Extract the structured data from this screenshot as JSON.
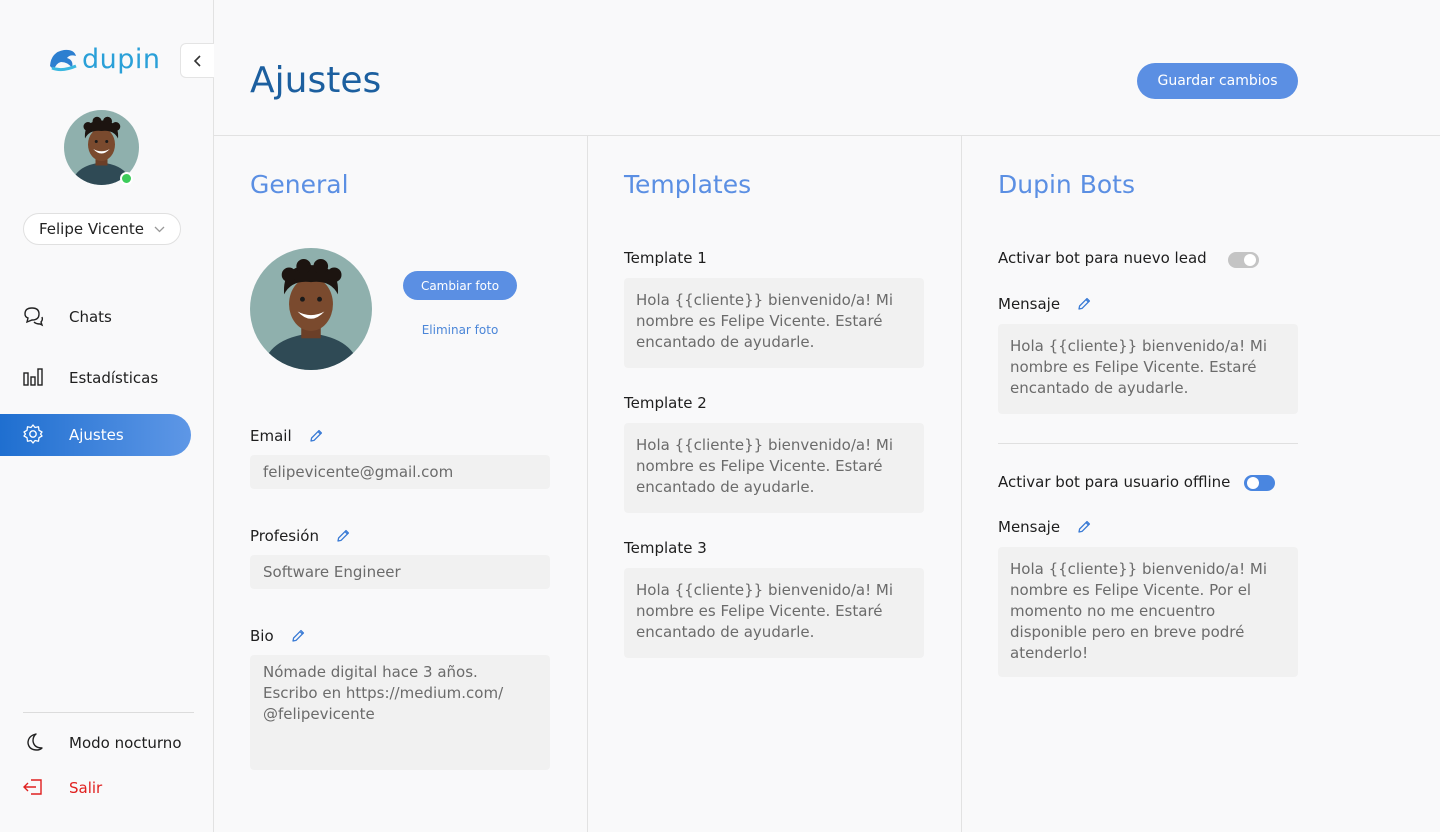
{
  "app": {
    "logo_text": "dupin",
    "user_name": "Felipe Vicente",
    "colors": {
      "accent": "#5b8fe3",
      "title": "#1c5f9f",
      "online": "#3ccc5a",
      "logout": "#e0201f"
    }
  },
  "sidebar": {
    "items": [
      {
        "label": "Chats",
        "icon": "chat-icon"
      },
      {
        "label": "Estadísticas",
        "icon": "stats-icon"
      },
      {
        "label": "Ajustes",
        "icon": "gear-icon",
        "active": true
      }
    ],
    "night_mode": "Modo nocturno",
    "logout": "Salir"
  },
  "header": {
    "title": "Ajustes",
    "save_label": "Guardar cambios"
  },
  "general": {
    "title": "General",
    "change_photo": "Cambiar foto",
    "remove_photo": "Eliminar foto",
    "email_label": "Email",
    "email_value": "felipevicente@gmail.com",
    "profession_label": "Profesión",
    "profession_value": "Software Engineer",
    "bio_label": "Bio",
    "bio_value": "Nómade digital hace 3 años. Escribo en https://medium.com/ @felipevicente"
  },
  "templates": {
    "title": "Templates",
    "items": [
      {
        "label": "Template 1",
        "text": "Hola {{cliente}} bienvenido/a! Mi nombre es Felipe Vicente. Estaré encantado de ayudarle."
      },
      {
        "label": "Template 2",
        "text": "Hola {{cliente}} bienvenido/a! Mi nombre es Felipe Vicente. Estaré encantado de ayudarle."
      },
      {
        "label": "Template 3",
        "text": "Hola {{cliente}} bienvenido/a! Mi nombre es Felipe Vicente. Estaré encantado de ayudarle."
      }
    ]
  },
  "bots": {
    "title": "Dupin Bots",
    "new_lead_label": "Activar bot para nuevo lead",
    "new_lead_enabled": false,
    "message_label": "Mensaje",
    "new_lead_message": "Hola {{cliente}} bienvenido/a! Mi nombre es Felipe Vicente. Estaré encantado de ayudarle.",
    "offline_label": "Activar bot para usuario offline",
    "offline_enabled": true,
    "offline_message": "Hola {{cliente}} bienvenido/a! Mi nombre es Felipe Vicente. Por el momento no me encuentro disponible pero en breve podré atenderlo!"
  }
}
